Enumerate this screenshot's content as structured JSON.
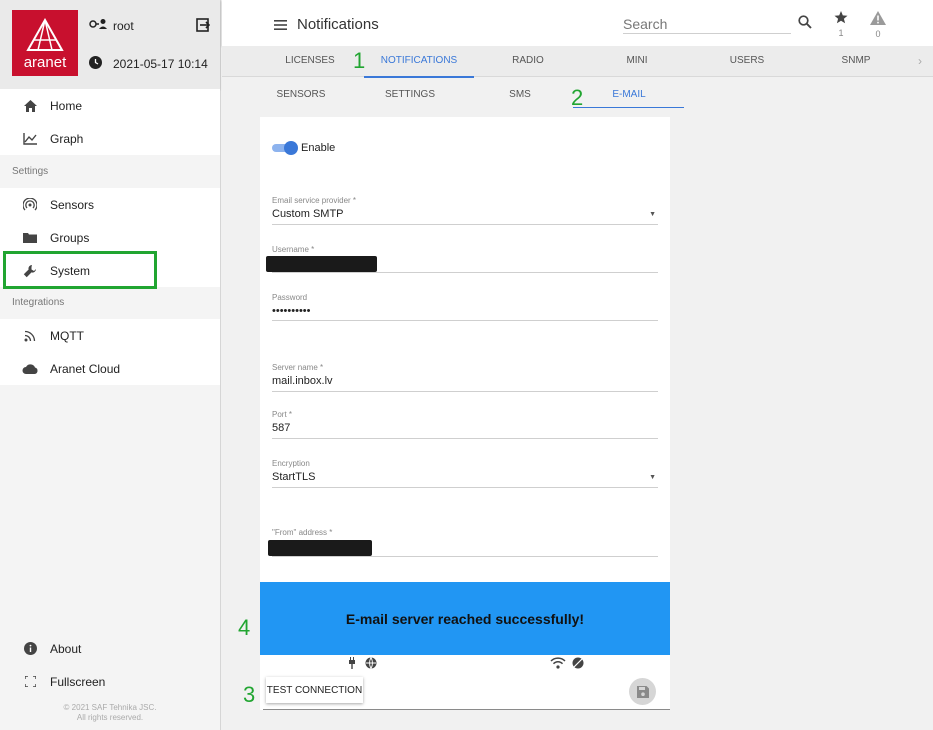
{
  "sidebar": {
    "logo_text": "aranet",
    "user": "root",
    "datetime": "2021-05-17 10:14",
    "nav": {
      "home": "Home",
      "graph": "Graph",
      "settings_section": "Settings",
      "sensors": "Sensors",
      "groups": "Groups",
      "system": "System",
      "integrations_section": "Integrations",
      "mqtt": "MQTT",
      "aranet_cloud": "Aranet Cloud",
      "about": "About",
      "fullscreen": "Fullscreen"
    },
    "copyright_line1": "© 2021 SAF Tehnika JSC.",
    "copyright_line2": "All rights reserved."
  },
  "header": {
    "title": "Notifications",
    "search_placeholder": "Search",
    "starred_count": "1",
    "alerts_count": "0"
  },
  "tabs_primary": [
    "LICENSES",
    "NOTIFICATIONS",
    "RADIO",
    "MINI",
    "USERS",
    "SNMP"
  ],
  "tabs_secondary": [
    "SENSORS",
    "SETTINGS",
    "SMS",
    "E-MAIL"
  ],
  "annotations": [
    "1",
    "2",
    "3",
    "4"
  ],
  "form": {
    "enable_label": "Enable",
    "enabled": true,
    "provider_label": "Email service provider *",
    "provider_value": "Custom SMTP",
    "username_label": "Username *",
    "password_label": "Password",
    "password_value": "••••••••••",
    "server_label": "Server name *",
    "server_value": "mail.inbox.lv",
    "port_label": "Port *",
    "port_value": "587",
    "encryption_label": "Encryption",
    "encryption_value": "StartTLS",
    "from_label": "\"From\" address *"
  },
  "banner": {
    "message": "E-mail server reached successfully!",
    "color": "#2196f3"
  },
  "actions": {
    "test_connection": "TEST CONNECTION"
  },
  "colors": {
    "accent": "#3a78d8",
    "brand": "#c8102e",
    "annotation": "#21a531"
  }
}
